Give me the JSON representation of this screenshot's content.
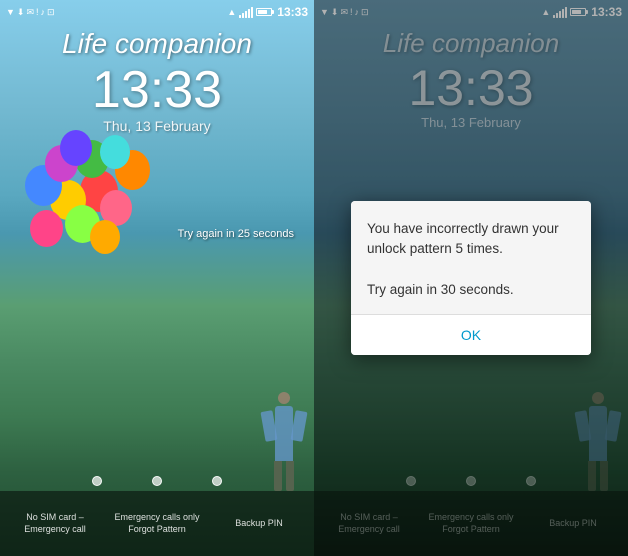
{
  "screens": [
    {
      "id": "left",
      "statusBar": {
        "time": "13:33",
        "icons": [
          "notification",
          "download",
          "gmail",
          "alert",
          "music",
          "screenshot"
        ]
      },
      "lockScreen": {
        "tagline": "Life companion",
        "time": "13:33",
        "date": "Thu, 13 February",
        "tryAgain": "Try again in 25 seconds"
      },
      "bottomBar": {
        "items": [
          {
            "label": "No SIM card –\nEmergency call"
          },
          {
            "divider": "–"
          },
          {
            "label": "Emergency calls only\nForgot Pattern"
          },
          {
            "label": "Backup PIN"
          }
        ]
      }
    },
    {
      "id": "right",
      "statusBar": {
        "time": "13:33"
      },
      "lockScreen": {
        "tagline": "Life companion",
        "time": "13:33",
        "date": "Thu, 13 February"
      },
      "dialog": {
        "message": "You have incorrectly drawn your unlock pattern 5 times.\n\nTry again in 30 seconds.",
        "button": "OK"
      },
      "bottomBar": {
        "items": [
          {
            "label": "No SIM card –\nEmergency call"
          },
          {
            "label": "Emergency calls only\nForgot Pattern"
          },
          {
            "label": "Backup PIN"
          }
        ]
      }
    }
  ],
  "colors": {
    "accent": "#0099cc",
    "dialogBg": "#f5f5f5",
    "dialogText": "#333333",
    "timeColor": "#ffffff",
    "dateColor": "rgba(255,255,255,0.9)"
  }
}
